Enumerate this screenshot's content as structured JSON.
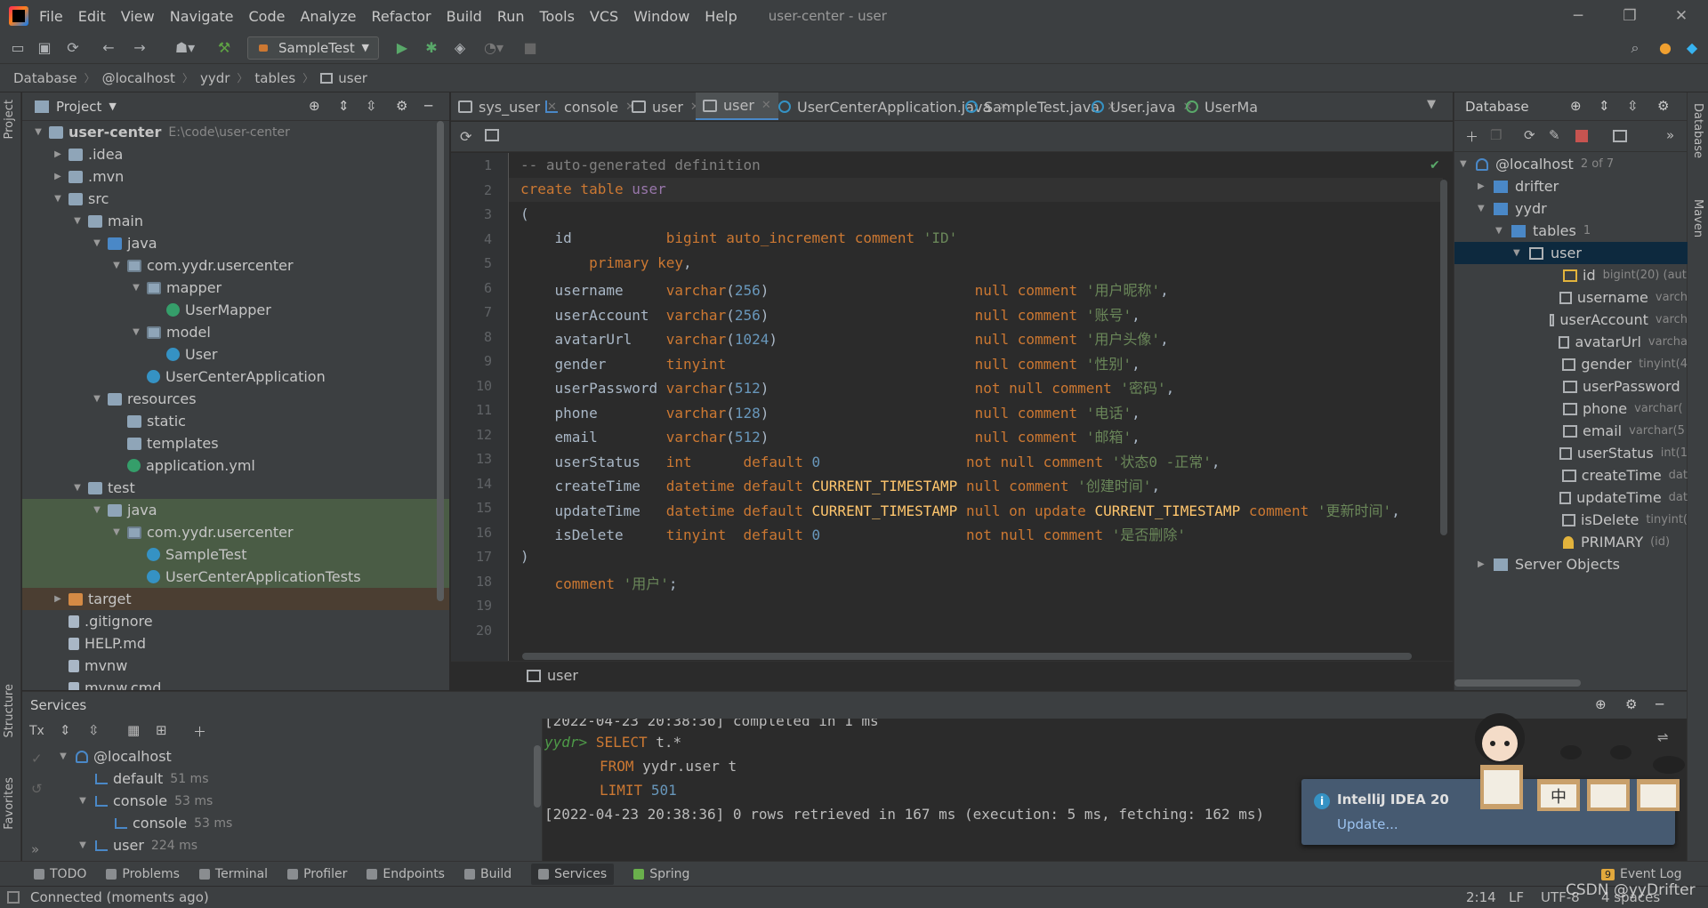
{
  "menubar": {
    "items": [
      "File",
      "Edit",
      "View",
      "Navigate",
      "Code",
      "Analyze",
      "Refactor",
      "Build",
      "Run",
      "Tools",
      "VCS",
      "Window",
      "Help"
    ],
    "window_title": "user-center - user"
  },
  "toolbar": {
    "run_config": "SampleTest"
  },
  "breadcrumb": [
    "Database",
    "@localhost",
    "yydr",
    "tables",
    "user"
  ],
  "project_panel": {
    "title": "Project",
    "tree": [
      {
        "label": "user-center",
        "extra": "E:\\code\\user-center",
        "depth": 0,
        "arrow": "v",
        "icon": "folder",
        "bold": true
      },
      {
        "label": ".idea",
        "depth": 1,
        "arrow": ">",
        "icon": "folder"
      },
      {
        "label": ".mvn",
        "depth": 1,
        "arrow": ">",
        "icon": "folder"
      },
      {
        "label": "src",
        "depth": 1,
        "arrow": "v",
        "icon": "folder"
      },
      {
        "label": "main",
        "depth": 2,
        "arrow": "v",
        "icon": "folder"
      },
      {
        "label": "java",
        "depth": 3,
        "arrow": "v",
        "icon": "folder-blue"
      },
      {
        "label": "com.yydr.usercenter",
        "depth": 4,
        "arrow": "v",
        "icon": "package"
      },
      {
        "label": "mapper",
        "depth": 5,
        "arrow": "v",
        "icon": "package"
      },
      {
        "label": "UserMapper",
        "depth": 6,
        "arrow": "",
        "icon": "interface"
      },
      {
        "label": "model",
        "depth": 5,
        "arrow": "v",
        "icon": "package"
      },
      {
        "label": "User",
        "depth": 6,
        "arrow": "",
        "icon": "class"
      },
      {
        "label": "UserCenterApplication",
        "depth": 5,
        "arrow": "",
        "icon": "class"
      },
      {
        "label": "resources",
        "depth": 3,
        "arrow": "v",
        "icon": "folder"
      },
      {
        "label": "static",
        "depth": 4,
        "arrow": "",
        "icon": "folder"
      },
      {
        "label": "templates",
        "depth": 4,
        "arrow": "",
        "icon": "folder"
      },
      {
        "label": "application.yml",
        "depth": 4,
        "arrow": "",
        "icon": "yml"
      },
      {
        "label": "test",
        "depth": 2,
        "arrow": "v",
        "icon": "folder"
      },
      {
        "label": "java",
        "depth": 3,
        "arrow": "v",
        "icon": "folder-green",
        "green": true
      },
      {
        "label": "com.yydr.usercenter",
        "depth": 4,
        "arrow": "v",
        "icon": "package",
        "green": true
      },
      {
        "label": "SampleTest",
        "depth": 5,
        "arrow": "",
        "icon": "class",
        "green": true
      },
      {
        "label": "UserCenterApplicationTests",
        "depth": 5,
        "arrow": "",
        "icon": "class",
        "green": true
      },
      {
        "label": "target",
        "depth": 1,
        "arrow": ">",
        "icon": "folder-orange",
        "brown": true
      },
      {
        "label": ".gitignore",
        "depth": 1,
        "arrow": "",
        "icon": "file"
      },
      {
        "label": "HELP.md",
        "depth": 1,
        "arrow": "",
        "icon": "file"
      },
      {
        "label": "mvnw",
        "depth": 1,
        "arrow": "",
        "icon": "file"
      },
      {
        "label": "mvnw.cmd",
        "depth": 1,
        "arrow": "",
        "icon": "file"
      }
    ]
  },
  "tabs": [
    {
      "label": "sys_user",
      "icon": "table"
    },
    {
      "label": "console",
      "icon": "console"
    },
    {
      "label": "user",
      "icon": "table"
    },
    {
      "label": "user",
      "icon": "table",
      "active": true
    },
    {
      "label": "UserCenterApplication.java",
      "icon": "class"
    },
    {
      "label": "SampleTest.java",
      "icon": "class"
    },
    {
      "label": "User.java",
      "icon": "class"
    },
    {
      "label": "UserMa",
      "icon": "interface"
    }
  ],
  "editor": {
    "footer_label": "user",
    "line_numbers": [
      "1",
      "2",
      "3",
      "4",
      "5",
      "6",
      "7",
      "8",
      "9",
      "10",
      "11",
      "12",
      "13",
      "14",
      "15",
      "16",
      "17",
      "18",
      "19",
      "20"
    ]
  },
  "database_panel": {
    "title": "Database",
    "host": "@localhost",
    "host_count": "2 of 7",
    "schemas": [
      "drifter",
      "yydr"
    ],
    "tables_label": "tables",
    "tables_count": "1",
    "table": "user",
    "columns": [
      {
        "name": "id",
        "type": "bigint(20) (aut",
        "key": true
      },
      {
        "name": "username",
        "type": "varch"
      },
      {
        "name": "userAccount",
        "type": "varch"
      },
      {
        "name": "avatarUrl",
        "type": "varcha"
      },
      {
        "name": "gender",
        "type": "tinyint(4"
      },
      {
        "name": "userPassword",
        "type": ""
      },
      {
        "name": "phone",
        "type": "varchar("
      },
      {
        "name": "email",
        "type": "varchar(5"
      },
      {
        "name": "userStatus",
        "type": "int(1"
      },
      {
        "name": "createTime",
        "type": "dat"
      },
      {
        "name": "updateTime",
        "type": "dat"
      },
      {
        "name": "isDelete",
        "type": "tinyint("
      }
    ],
    "primary": "PRIMARY",
    "primary_type": "(id)",
    "server_objects": "Server Objects"
  },
  "services": {
    "title": "Services",
    "tree": [
      {
        "label": "@localhost",
        "time": ""
      },
      {
        "label": "default",
        "time": "51 ms"
      },
      {
        "label": "console",
        "time": "53 ms"
      },
      {
        "label": "console",
        "time": "53 ms"
      },
      {
        "label": "user",
        "time": "224 ms"
      }
    ],
    "console": {
      "line0": "[2022-04-23 20:38:36] completed in 1 ms",
      "prompt": "yydr>",
      "q1": "SELECT",
      "q1b": "t.*",
      "q2": "FROM",
      "q2b": "yydr.user t",
      "q3": "LIMIT",
      "q3b": "501",
      "result": "[2022-04-23 20:38:36] 0 rows retrieved in 167 ms (execution: 5 ms, fetching: 162 ms)"
    }
  },
  "notification": {
    "title": "IntelliJ IDEA 20",
    "link": "Update..."
  },
  "bottom_tools": [
    "TODO",
    "Problems",
    "Terminal",
    "Profiler",
    "Endpoints",
    "Build",
    "Services",
    "Spring"
  ],
  "event_log": {
    "count": "9",
    "label": "Event Log"
  },
  "status": {
    "message": "Connected (moments ago)",
    "position": "2:14",
    "line_sep": "LF",
    "encoding": "UTF-8",
    "indent": "4 spaces",
    "watermark": "CSDN @yyDrifter"
  },
  "side_labels": {
    "project": "Project",
    "structure": "Structure",
    "favorites": "Favorites",
    "database": "Database",
    "maven": "Maven"
  },
  "colors": {
    "bg": "#2b2b2b",
    "panel": "#3c3f41",
    "keyword": "#cc7832",
    "string": "#6a8759",
    "number": "#6897bb",
    "comment": "#808080"
  }
}
